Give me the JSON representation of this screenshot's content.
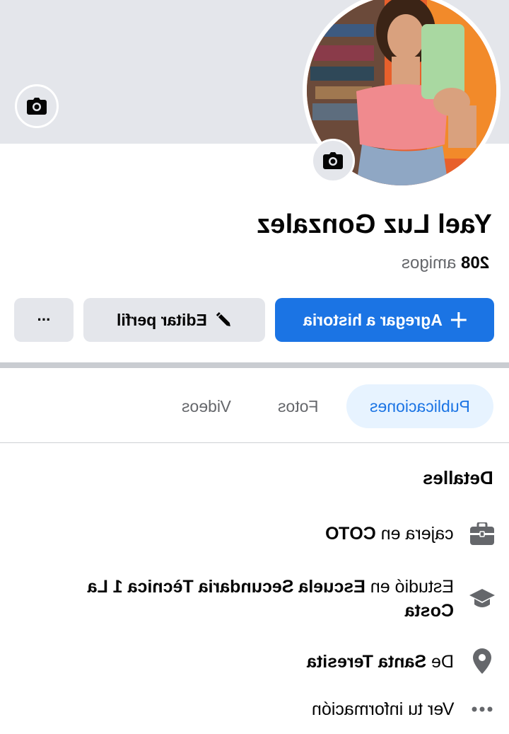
{
  "profile": {
    "name": "Yael Luz Gonzalez",
    "friends_count": "208",
    "friends_label": "amigos"
  },
  "actions": {
    "add_story_label": "Agregar a historia",
    "edit_profile_label": "Editar perfil",
    "more_label": "···"
  },
  "tabs": [
    {
      "label": "Publicaciones",
      "active": true
    },
    {
      "label": "Fotos",
      "active": false
    },
    {
      "label": "Videos",
      "active": false
    }
  ],
  "details": {
    "title": "Detalles",
    "work": {
      "prefix": "cajera en ",
      "place": "COTO"
    },
    "education": {
      "prefix": "Estudió en ",
      "place": "Escuela Secundaria Tècnica 1 La Costa"
    },
    "hometown": {
      "prefix": "De ",
      "place": "Santa Teresita"
    },
    "more_info": "Ver tu información"
  },
  "colors": {
    "accent": "#1b74e4",
    "cover_bg": "#e4e6eb",
    "active_tab_bg": "#e7f3ff",
    "muted_text": "#65676b"
  },
  "icons": {
    "cover_camera": "camera-icon",
    "avatar_camera": "camera-icon",
    "story": "plus-icon",
    "edit": "pencil-icon",
    "work": "briefcase-icon",
    "education": "graduation-cap-icon",
    "hometown": "location-pin-icon",
    "more_info": "more-dots-icon"
  }
}
